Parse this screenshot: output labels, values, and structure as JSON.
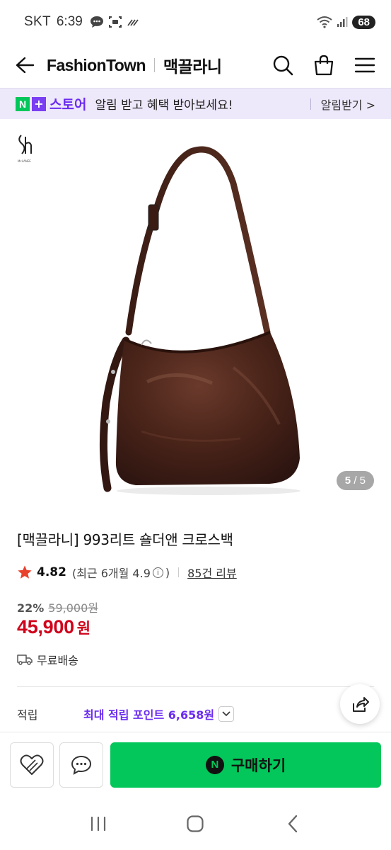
{
  "status_bar": {
    "carrier": "SKT",
    "time": "6:39",
    "battery": "68",
    "icons": [
      "chat-bubble-icon",
      "screenshot-icon",
      "signal-slash-icon",
      "wifi-icon",
      "cellular-signal-icon",
      "battery-icon"
    ]
  },
  "header": {
    "brand": "FashionTown",
    "store": "맥끌라니",
    "icons": [
      "back-arrow-icon",
      "search-icon",
      "shopping-bag-icon",
      "menu-icon"
    ]
  },
  "notice": {
    "badge_n": "N",
    "badge_plus": "+",
    "badge_store": "스토어",
    "text": "알림 받고 혜택 받아보세요!",
    "link": "알림받기 >"
  },
  "gallery": {
    "current": "5",
    "separator": "/",
    "total": "5"
  },
  "product": {
    "title": "[맥끌라니] 993리트 숄더앤 크로스백",
    "rating": "4.82",
    "recent_prefix": "(최근 6개월 4.9",
    "recent_suffix": ")",
    "reviews": "85건 리뷰",
    "discount_rate": "22%",
    "original_price": "59,000원",
    "price": "45,900",
    "price_unit": "원",
    "shipping": "무료배송"
  },
  "points": {
    "label": "적립",
    "value": "최대 적립 포인트 6,658원"
  },
  "actions": {
    "buy_label": "구매하기",
    "buy_badge": "N"
  },
  "colors": {
    "naver_green": "#03c75a",
    "purple": "#6a2cf0",
    "price_red": "#d0021b",
    "notice_bg": "#eee8fb"
  }
}
